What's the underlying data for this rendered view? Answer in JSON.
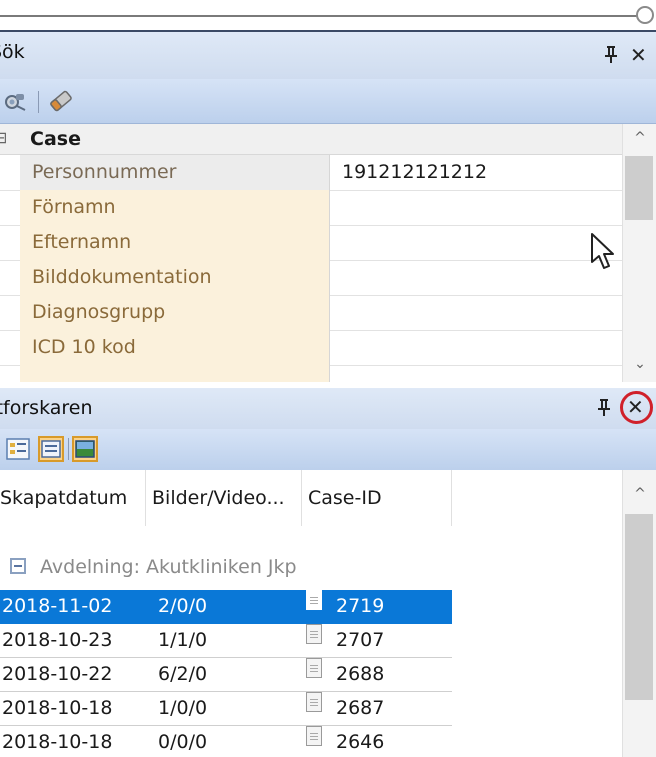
{
  "search_panel": {
    "title": "Sök",
    "pin_glyph": "ȩ",
    "close_glyph": "✕",
    "toolbar": {
      "icons": [
        "search-binoculars-icon",
        "eraser-icon"
      ]
    },
    "category": {
      "expander": "⊟",
      "label": "Case"
    },
    "properties": [
      {
        "name": "Personnummer",
        "value": "191212121212",
        "selected": true
      },
      {
        "name": "Förnamn",
        "value": ""
      },
      {
        "name": "Efternamn",
        "value": ""
      },
      {
        "name": "Bilddokumentation",
        "value": ""
      },
      {
        "name": "Diagnosgrupp",
        "value": ""
      },
      {
        "name": "ICD 10 kod",
        "value": ""
      }
    ],
    "scroll_up": "^",
    "scroll_down": "⌄"
  },
  "explorer_panel": {
    "title": "Jtforskaren",
    "pin_glyph": "ȩ",
    "close_glyph": "✕",
    "toolbar": {
      "icons": [
        "tree-view-icon",
        "details-view-icon",
        "thumbnail-view-icon"
      ]
    },
    "columns": [
      "Skapatdatum",
      "Bilder/Video...",
      "Case-ID"
    ],
    "group": {
      "label": "Avdelning: Akutkliniken Jkp"
    },
    "rows": [
      {
        "date": "2018-11-02",
        "media": "2/0/0",
        "case_id": "2719",
        "selected": true
      },
      {
        "date": "2018-10-23",
        "media": "1/1/0",
        "case_id": "2707"
      },
      {
        "date": "2018-10-22",
        "media": "6/2/0",
        "case_id": "2688"
      },
      {
        "date": "2018-10-18",
        "media": "1/0/0",
        "case_id": "2687"
      },
      {
        "date": "2018-10-18",
        "media": "0/0/0",
        "case_id": "2646"
      }
    ],
    "scroll_up": "^"
  },
  "colors": {
    "selection": "#0a78d7",
    "highlight_ring": "#d0202a",
    "property_name_bg": "#fbf1dc"
  }
}
